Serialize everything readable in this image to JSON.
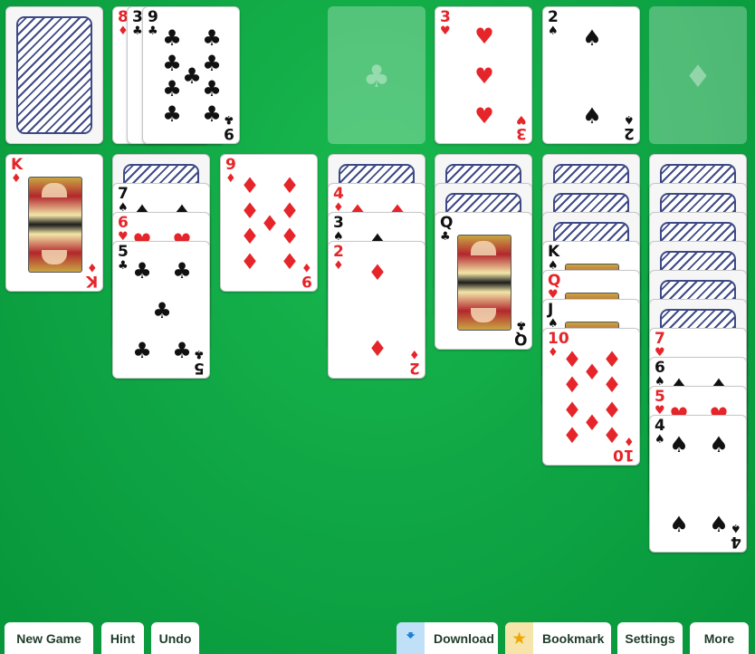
{
  "toolbar": {
    "new_game": "New Game",
    "hint": "Hint",
    "undo": "Undo",
    "download": "Download",
    "bookmark": "Bookmark",
    "settings": "Settings",
    "more": "More"
  },
  "colors": {
    "felt": "#0ea444",
    "red_suit": "#e5252a",
    "card_back": "#3e4a86"
  },
  "stock": {
    "face_down": true
  },
  "waste": [
    {
      "rank": "8",
      "suit": "♦"
    },
    {
      "rank": "3",
      "suit": "♣"
    },
    {
      "rank": "9",
      "suit": "♣"
    }
  ],
  "foundations": [
    {
      "empty_suit_icon": "♣"
    },
    {
      "rank": "3",
      "suit": "♥"
    },
    {
      "rank": "2",
      "suit": "♠"
    },
    {
      "empty_suit_icon": "♦"
    }
  ],
  "tableau": [
    {
      "hidden": 0,
      "cards": [
        {
          "rank": "K",
          "suit": "♦"
        }
      ]
    },
    {
      "hidden": 1,
      "cards": [
        {
          "rank": "7",
          "suit": "♠"
        },
        {
          "rank": "6",
          "suit": "♥"
        },
        {
          "rank": "5",
          "suit": "♣"
        }
      ]
    },
    {
      "hidden": 0,
      "cards": [
        {
          "rank": "9",
          "suit": "♦"
        }
      ]
    },
    {
      "hidden": 1,
      "cards": [
        {
          "rank": "4",
          "suit": "♦"
        },
        {
          "rank": "3",
          "suit": "♠"
        },
        {
          "rank": "2",
          "suit": "♦"
        }
      ]
    },
    {
      "hidden": 2,
      "cards": [
        {
          "rank": "Q",
          "suit": "♣"
        }
      ]
    },
    {
      "hidden": 3,
      "cards": [
        {
          "rank": "K",
          "suit": "♠"
        },
        {
          "rank": "Q",
          "suit": "♥"
        },
        {
          "rank": "J",
          "suit": "♠"
        },
        {
          "rank": "10",
          "suit": "♦"
        }
      ]
    },
    {
      "hidden": 6,
      "cards": [
        {
          "rank": "7",
          "suit": "♥"
        },
        {
          "rank": "6",
          "suit": "♠"
        },
        {
          "rank": "5",
          "suit": "♥"
        },
        {
          "rank": "4",
          "suit": "♠"
        }
      ]
    }
  ]
}
